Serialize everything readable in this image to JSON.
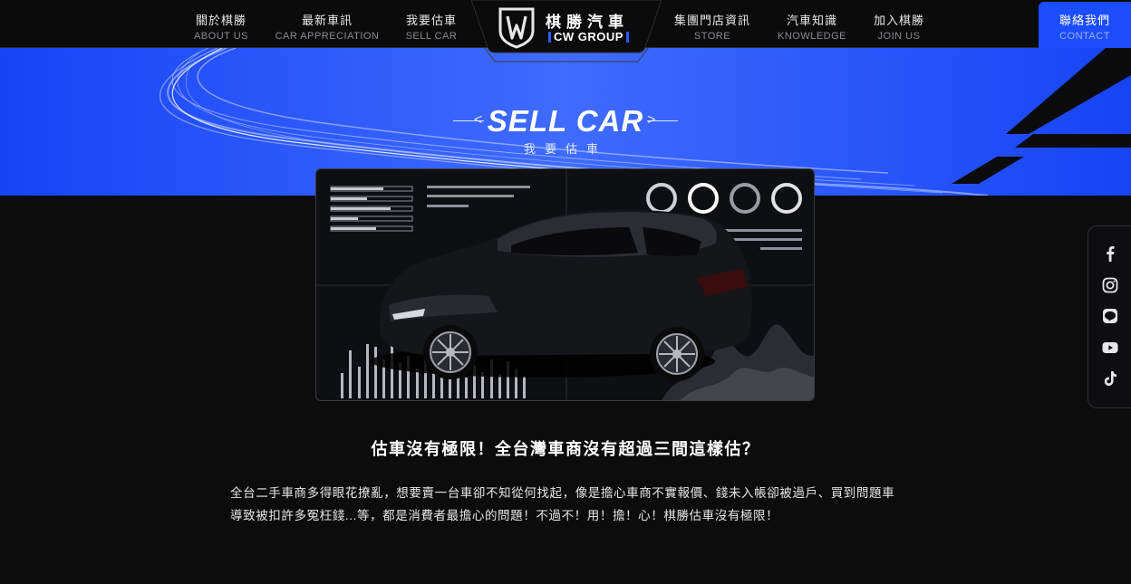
{
  "nav": {
    "items_left": [
      {
        "zh": "關於棋勝",
        "en": "ABOUT US"
      },
      {
        "zh": "最新車訊",
        "en": "CAR APPRECIATION"
      },
      {
        "zh": "我要估車",
        "en": "SELL CAR"
      }
    ],
    "items_right": [
      {
        "zh": "集團門店資訊",
        "en": "STORE"
      },
      {
        "zh": "汽車知識",
        "en": "KNOWLEDGE"
      },
      {
        "zh": "加入棋勝",
        "en": "JOIN US"
      }
    ],
    "contact": {
      "zh": "聯絡我們",
      "en": "CONTACT"
    }
  },
  "logo": {
    "zh": "棋勝汽車",
    "en": "CW GROUP"
  },
  "hero": {
    "title": "SELL CAR",
    "subtitle": "我要估車"
  },
  "content": {
    "headline": "估車沒有極限！全台灣車商沒有超過三間這樣估？",
    "body": "全台二手車商多得眼花撩亂，想要賣一台車卻不知從何找起，像是擔心車商不實報價、錢未入帳卻被過戶、買到問題車導致被扣許多冤枉錢...等，都是消費者最擔心的問題！不過不！用！擔！心！棋勝估車沒有極限！"
  },
  "social": [
    "facebook-icon",
    "instagram-icon",
    "line-icon",
    "youtube-icon",
    "tiktok-icon"
  ],
  "colors": {
    "brand_blue": "#1c4dff",
    "background": "#0c0c0d"
  }
}
